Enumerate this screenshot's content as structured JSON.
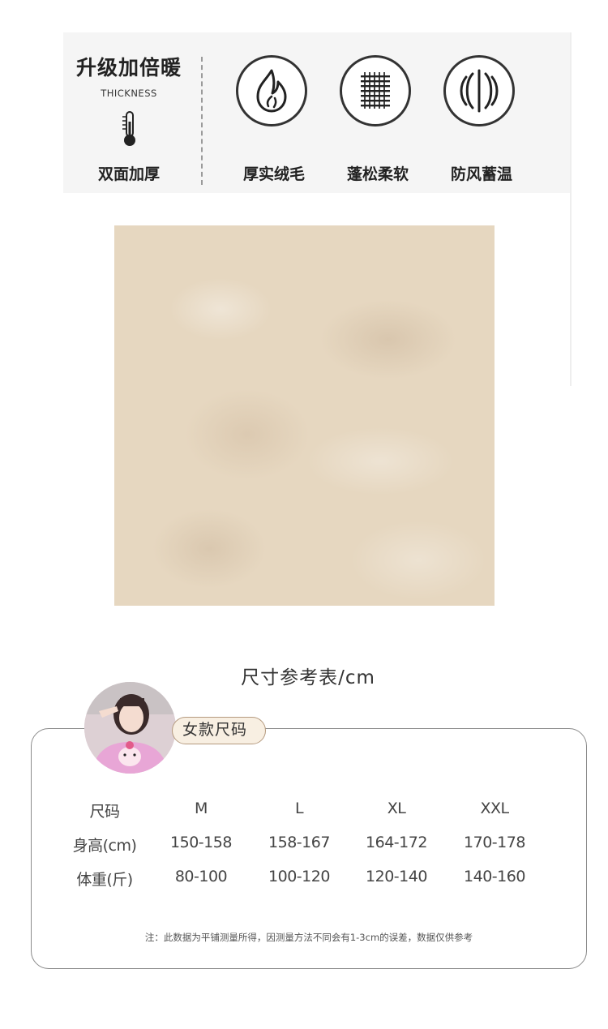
{
  "features": {
    "thickness_title": "升级加倍暖",
    "thickness_subtitle": "THICKNESS",
    "thickness_caption": "双面加厚",
    "thermometer_icon": "thermometer-icon",
    "items": [
      {
        "icon": "flame-icon",
        "label": "厚实绒毛"
      },
      {
        "icon": "knit-grid-icon",
        "label": "蓬松柔软"
      },
      {
        "icon": "wind-shield-icon",
        "label": "防风蓄温"
      }
    ]
  },
  "swatch": {
    "color": "#e6d7c0"
  },
  "size_chart": {
    "title": "尺寸参考表/cm",
    "badge": "女款尺码",
    "rows": [
      [
        "尺码",
        "M",
        "L",
        "XL",
        "XXL"
      ],
      [
        "身高(cm)",
        "150-158",
        "158-167",
        "164-172",
        "170-178"
      ],
      [
        "体重(斤)",
        "80-100",
        "100-120",
        "120-140",
        "140-160"
      ]
    ],
    "note": "注：此数据为平铺测量所得，因测量方法不同会有1-3cm的误差，数据仅供参考"
  }
}
